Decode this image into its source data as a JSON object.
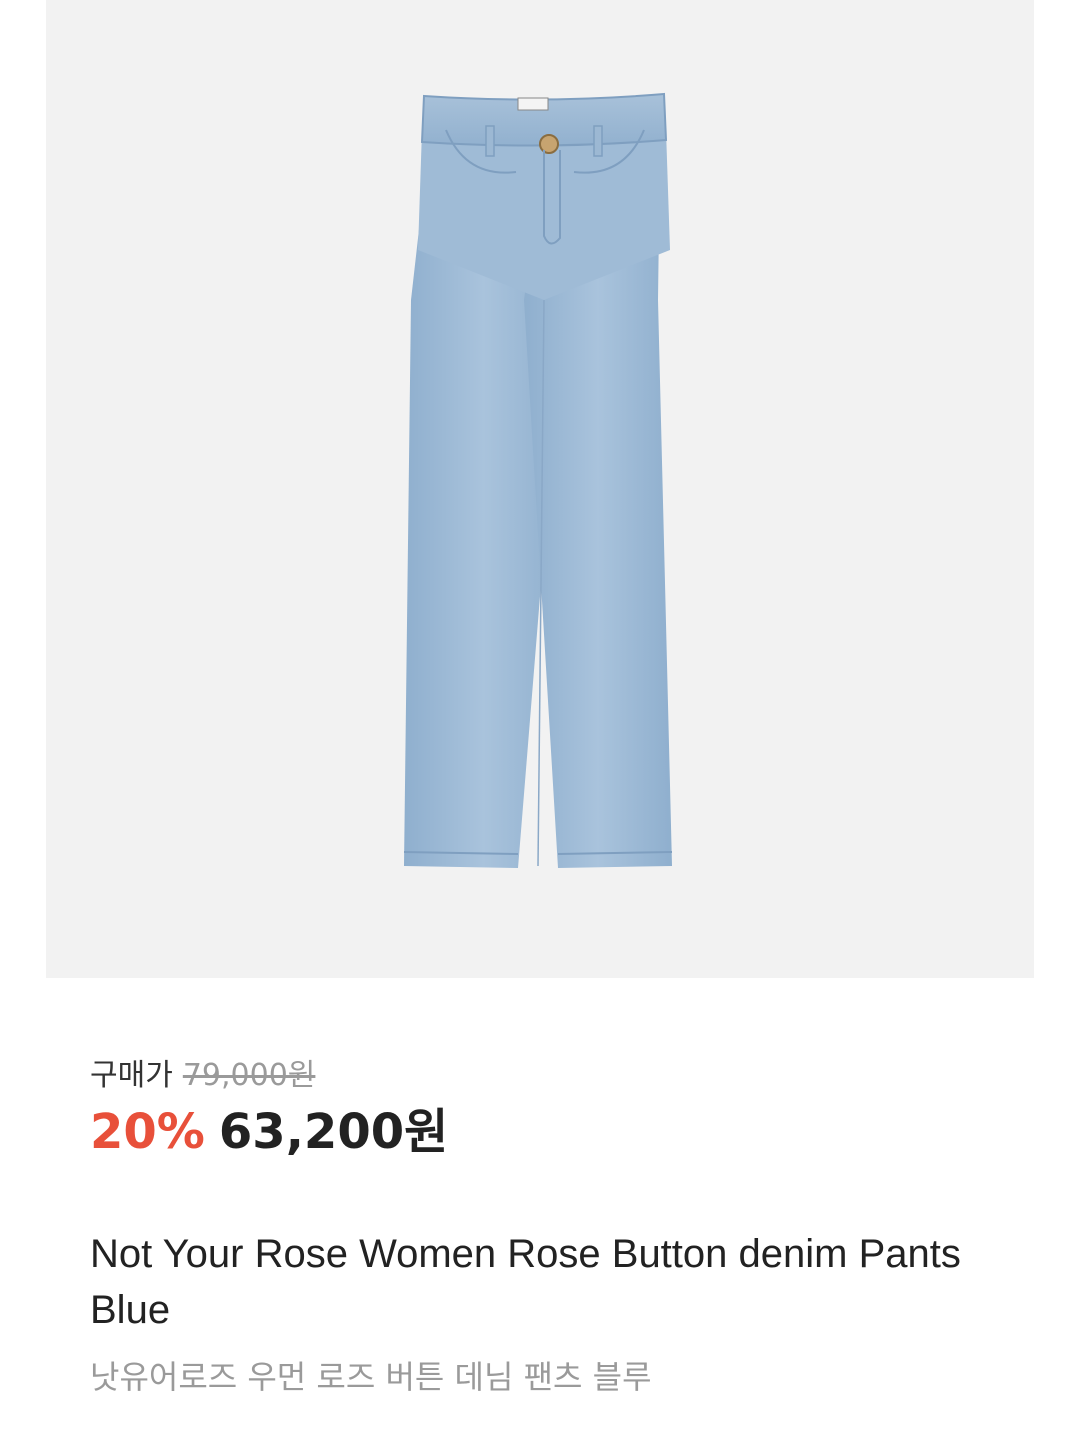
{
  "price": {
    "label": "구매가",
    "original": "79,000원",
    "discount": "20%",
    "sale": "63,200원"
  },
  "product": {
    "title_en": "Not Your Rose Women Rose Button denim Pants Blue",
    "title_ko": "낫유어로즈 우먼 로즈 버튼 데님 팬츠 블루",
    "image_name": "denim-pants-image"
  },
  "colors": {
    "image_bg": "#f2f2f2",
    "discount": "#e8503a",
    "denim": "#9dbad6"
  }
}
